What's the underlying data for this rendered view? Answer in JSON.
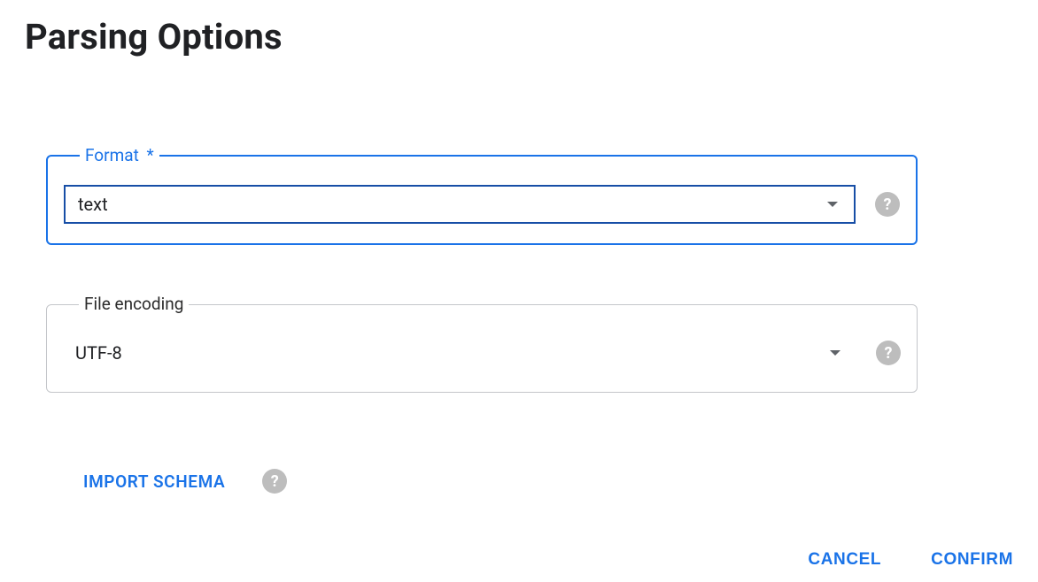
{
  "title": "Parsing Options",
  "format_field": {
    "label": "Format",
    "required_marker": "*",
    "value": "text"
  },
  "encoding_field": {
    "label": "File encoding",
    "value": "UTF-8"
  },
  "import_schema_label": "IMPORT SCHEMA",
  "help_glyph": "?",
  "buttons": {
    "cancel": "CANCEL",
    "confirm": "CONFIRM"
  }
}
